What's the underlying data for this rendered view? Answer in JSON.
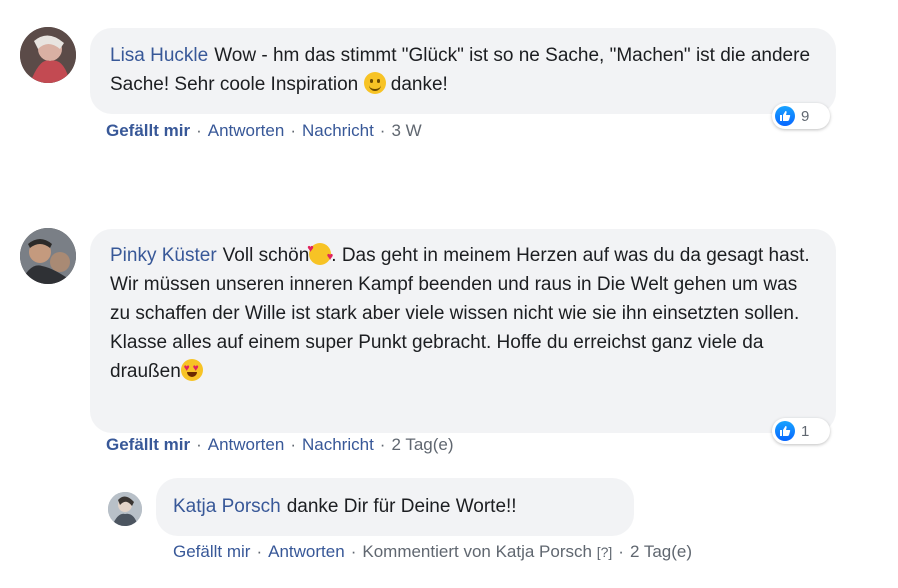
{
  "comments": [
    {
      "author": "Lisa Huckle",
      "text_before_emoji": "Wow - hm das stimmt \"Glück\" ist so ne Sache, \"Machen\" ist die andere Sache! Sehr coole Inspiration ",
      "text_after_emoji": " danke!",
      "emoji": "slightly-smiling-face-icon",
      "reaction_count": "9",
      "actions": {
        "like": "Gefällt mir",
        "reply": "Antworten",
        "message": "Nachricht",
        "time": "3 W"
      }
    },
    {
      "author": "Pinky Küster",
      "text_part1": "Voll schön",
      "text_part2": ". Das geht in meinem Herzen auf was du da gesagt hast. Wir müssen unseren inneren Kampf beenden und raus in Die Welt gehen um was zu schaffen der Wille ist stark aber viele wissen nicht wie sie ihn einsetzten sollen. Klasse alles auf einem super Punkt gebracht. Hoffe du erreichst ganz viele da draußen",
      "emoji1": "smiling-face-with-hearts-icon",
      "emoji2": "heart-eyes-icon",
      "reaction_count": "1",
      "actions": {
        "like": "Gefällt mir",
        "reply": "Antworten",
        "message": "Nachricht",
        "time": "2 Tag(e)"
      }
    }
  ],
  "reply": {
    "author": "Katja Porsch",
    "text": "danke Dir für Deine Worte!!",
    "actions": {
      "like": "Gefällt mir",
      "reply": "Antworten",
      "commented_by": "Kommentiert von Katja Porsch",
      "help": "[?]",
      "time": "2 Tag(e)"
    }
  },
  "colors": {
    "link": "#385898",
    "bubble": "#f2f3f5",
    "muted": "#606770",
    "like_blue": "#0866ff"
  }
}
